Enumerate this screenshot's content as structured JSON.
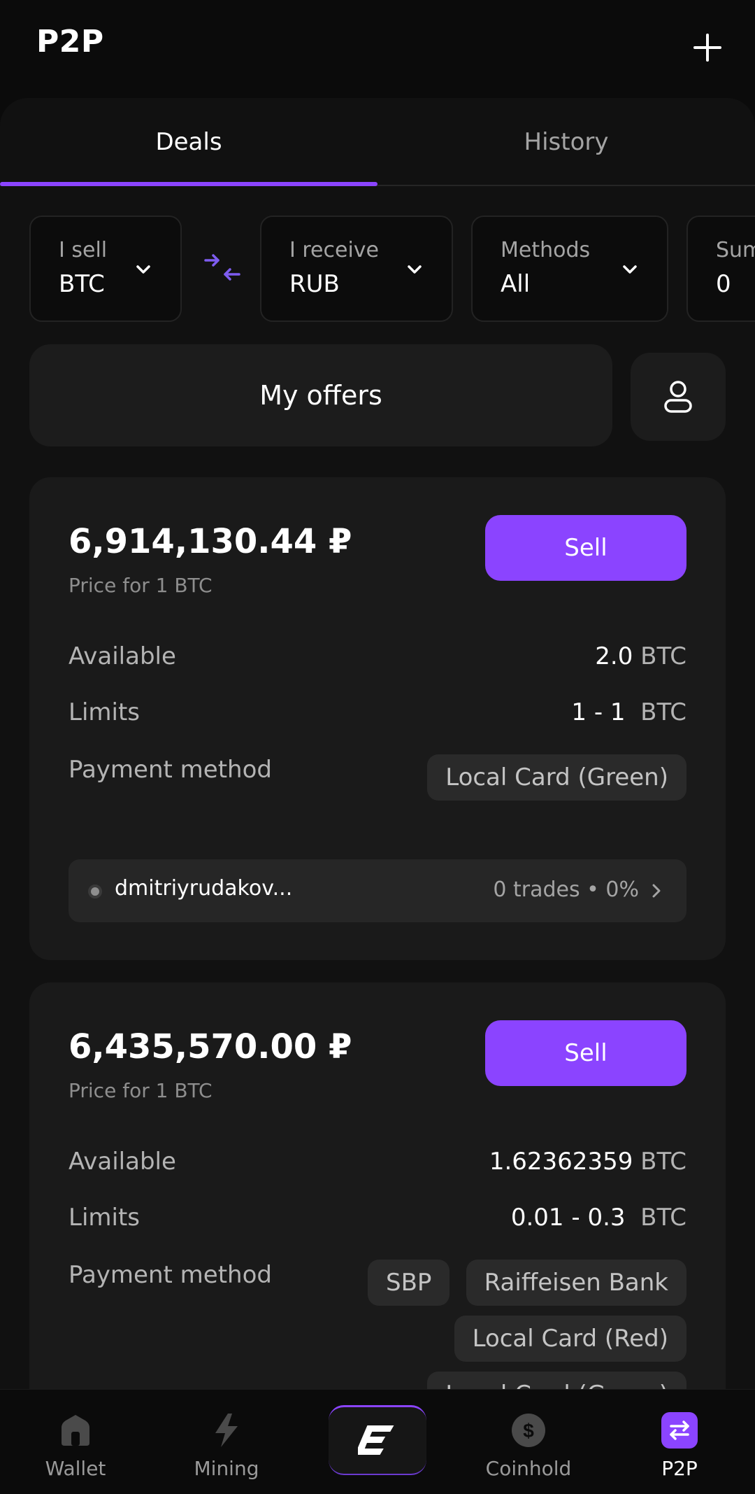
{
  "header": {
    "title": "P2P",
    "add_icon": "plus-icon"
  },
  "tabs": [
    {
      "label": "Deals",
      "active": true
    },
    {
      "label": "History",
      "active": false
    }
  ],
  "filters": {
    "sell": {
      "label": "I sell",
      "value": "BTC"
    },
    "receive": {
      "label": "I receive",
      "value": "RUB"
    },
    "methods": {
      "label": "Methods",
      "value": "All"
    },
    "sum": {
      "label": "Sum",
      "value": "0"
    }
  },
  "my_offers_label": "My offers",
  "offers": [
    {
      "price": "6,914,130.44 ₽",
      "price_note": "Price for 1 BTC",
      "sell_label": "Sell",
      "available_label": "Available",
      "available_value": "2.0",
      "available_unit": "BTC",
      "limits_label": "Limits",
      "limits_value": "1 - 1",
      "limits_unit": "BTC",
      "payment_label": "Payment method",
      "payment_methods": [
        "Local Card (Green)"
      ],
      "trader": {
        "name": "dmitriyrudakov...",
        "stats": "0 trades • 0%"
      }
    },
    {
      "price": "6,435,570.00 ₽",
      "price_note": "Price for 1 BTC",
      "sell_label": "Sell",
      "available_label": "Available",
      "available_value": "1.62362359",
      "available_unit": "BTC",
      "limits_label": "Limits",
      "limits_value": "0.01 - 0.3",
      "limits_unit": "BTC",
      "payment_label": "Payment method",
      "payment_methods": [
        "SBP",
        "Raiffeisen Bank",
        "Local Card (Red)",
        "Local Card (Green)"
      ]
    }
  ],
  "nav": [
    {
      "label": "Wallet",
      "icon": "wallet-icon",
      "active": false
    },
    {
      "label": "Mining",
      "icon": "lightning-icon",
      "active": false
    },
    {
      "label": "",
      "icon": "e-logo-icon",
      "active": false
    },
    {
      "label": "Coinhold",
      "icon": "dollar-coin-icon",
      "active": false
    },
    {
      "label": "P2P",
      "icon": "swap-arrows-icon",
      "active": true
    }
  ],
  "colors": {
    "accent": "#8b44ff",
    "background": "#0b0b0b",
    "card": "#1a1a1a"
  }
}
